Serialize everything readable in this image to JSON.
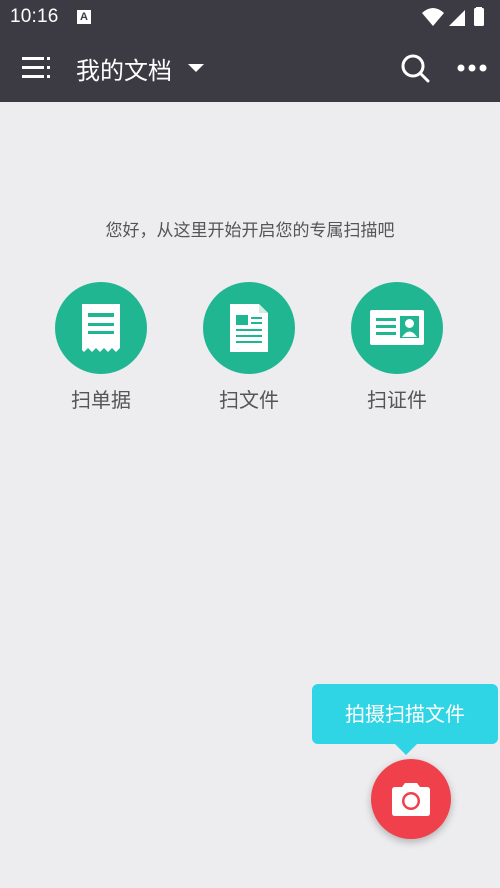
{
  "status_bar": {
    "time": "10:16",
    "app_badge": "A",
    "icons": [
      "wifi-icon",
      "signal-icon",
      "battery-icon"
    ]
  },
  "app_bar": {
    "title": "我的文档",
    "icons": [
      "menu-icon",
      "dropdown-caret-icon",
      "search-icon",
      "more-options-icon"
    ],
    "background": "#3c3b44"
  },
  "main": {
    "welcome_text": "您好，从这里开始开启您的专属扫描吧",
    "scan_options": [
      {
        "label": "扫单据",
        "icon": "receipt-icon"
      },
      {
        "label": "扫文件",
        "icon": "document-icon"
      },
      {
        "label": "扫证件",
        "icon": "id-card-icon"
      }
    ],
    "accent": "#21b692"
  },
  "tooltip": {
    "text": "拍摄扫描文件",
    "color": "#2fd5e4"
  },
  "fab": {
    "icon": "camera-icon",
    "color": "#f0404c"
  }
}
